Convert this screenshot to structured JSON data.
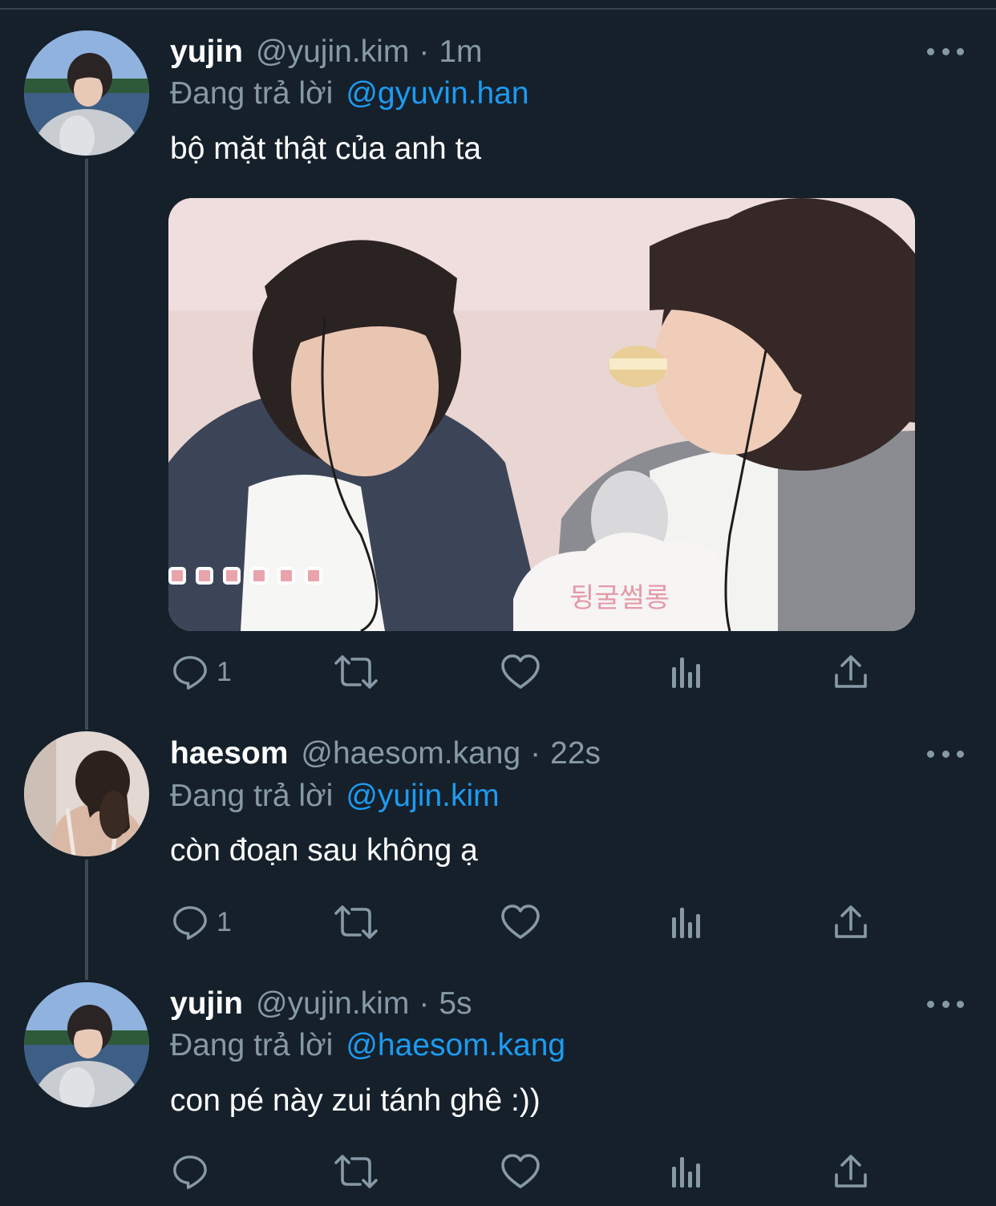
{
  "tweets": [
    {
      "name": "yujin",
      "handle": "@yujin.kim",
      "separator": "·",
      "time": "1m",
      "reply_label": "Đang trả lời",
      "reply_to": "@gyuvin.han",
      "text": "bộ mặt thật của anh ta",
      "reply_count": "1",
      "media_overlay_text": "뒹굴썰롱"
    },
    {
      "name": "haesom",
      "handle": "@haesom.kang",
      "separator": "·",
      "time": "22s",
      "reply_label": "Đang trả lời",
      "reply_to": "@yujin.kim",
      "text": "còn đoạn sau không ạ",
      "reply_count": "1"
    },
    {
      "name": "yujin",
      "handle": "@yujin.kim",
      "separator": "·",
      "time": "5s",
      "reply_label": "Đang trả lời",
      "reply_to": "@haesom.kang",
      "text": "con pé này zui tánh ghê :))",
      "reply_count": ""
    }
  ],
  "colors": {
    "background": "#15202b",
    "text": "#ffffff",
    "muted": "#8899a6",
    "link": "#1d9bf0",
    "thread_line": "#3d4a56"
  },
  "icons": [
    "reply-icon",
    "retweet-icon",
    "like-icon",
    "analytics-icon",
    "share-icon",
    "more-icon"
  ]
}
